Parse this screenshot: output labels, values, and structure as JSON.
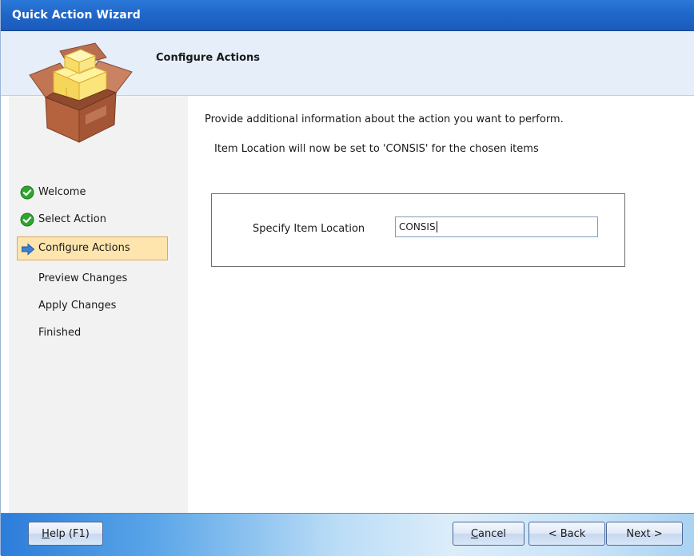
{
  "window": {
    "title": "Quick Action Wizard"
  },
  "header": {
    "heading": "Configure Actions",
    "icon": "package-box-icon"
  },
  "sidebar": {
    "steps": [
      {
        "label": "Welcome",
        "status": "done",
        "icon": "check-circle-icon"
      },
      {
        "label": "Select Action",
        "status": "done",
        "icon": "check-circle-icon"
      },
      {
        "label": "Configure Actions",
        "status": "current",
        "icon": "arrow-right-icon"
      },
      {
        "label": "Preview Changes",
        "status": "pending"
      },
      {
        "label": "Apply Changes",
        "status": "pending"
      },
      {
        "label": "Finished",
        "status": "pending"
      }
    ]
  },
  "main": {
    "intro": "Provide additional information about the action you want to perform.",
    "info": "Item Location will now be set to 'CONSIS' for the chosen items",
    "field": {
      "label": "Specify Item Location",
      "value": "CONSIS"
    }
  },
  "footer": {
    "help_label_mnemonic": "H",
    "help_label_rest": "elp (F1)",
    "cancel_label_mnemonic": "C",
    "cancel_label_rest": "ancel",
    "back_label": "< Back",
    "next_label": "Next >"
  },
  "colors": {
    "titlebar": "#2067c9",
    "header_bg": "#e6eefa",
    "sidebar_bg": "#f2f2f2",
    "current_step_bg": "#fde5ad",
    "check_green": "#2fa52f",
    "arrow_blue": "#3b7fd6"
  }
}
